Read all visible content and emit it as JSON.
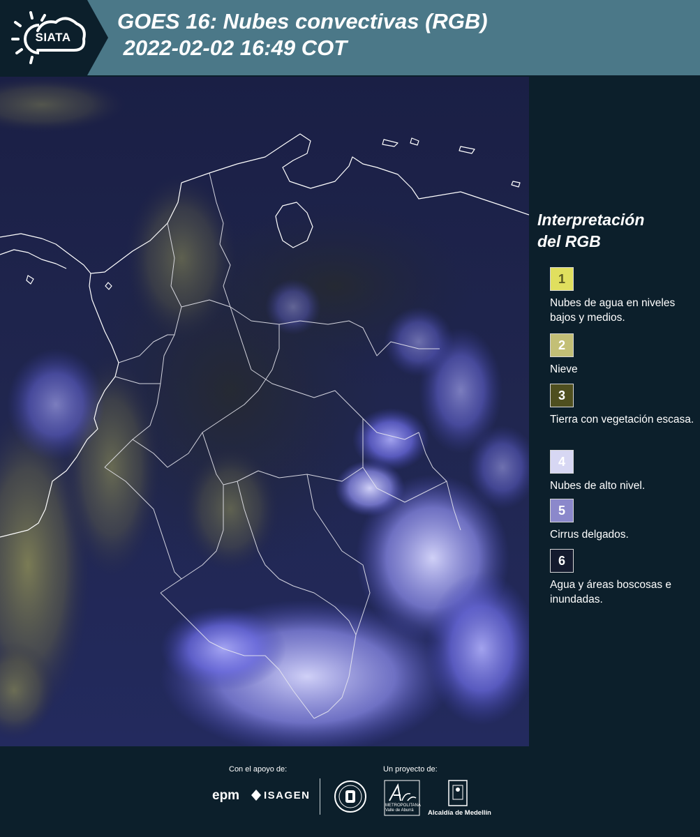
{
  "header": {
    "logo_text": "SIATA",
    "title": "GOES 16: Nubes convectivas (RGB)\n 2022-02-02 16:49 COT"
  },
  "legend": {
    "title": "Interpretación\ndel RGB",
    "items": [
      {
        "number": "1",
        "label": "Nubes de agua en niveles bajos y medios.",
        "color": "#e0df5e",
        "text_color": "#5a5a20"
      },
      {
        "number": "2",
        "label": "Nieve",
        "color": "#c3bf76",
        "text_color": "#ffffff"
      },
      {
        "number": "3",
        "label": "Tierra con vegetación escasa.",
        "color": "#4f4f1f",
        "text_color": "#ffffff"
      },
      {
        "number": "4",
        "label": "Nubes de alto nivel.",
        "color": "#d7d7f3",
        "text_color": "#ffffff"
      },
      {
        "number": "5",
        "label": "Cirrus delgados.",
        "color": "#8b88cb",
        "text_color": "#ffffff"
      },
      {
        "number": "6",
        "label": "Agua y áreas boscosas e inundadas.",
        "color": "#141a2e",
        "text_color": "#ffffff"
      }
    ]
  },
  "footer": {
    "support_label": "Con el apoyo de:",
    "project_label": "Un proyecto de:",
    "sponsors": [
      "epm",
      "ISAGEN"
    ],
    "partners": [
      "Área Metropolitana Valle de Aburrá",
      "Alcaldía de Medellín"
    ],
    "area_text": "METROPOLITANA\nValle de Aburrá",
    "alcaldia_text": "Alcaldía de Medellín",
    "epm_text": "epm",
    "isagen_text": "ISAGEN"
  },
  "colors": {
    "header_bg": "#4b7888",
    "dark_bg": "#0c1f2b",
    "map_bg": "#1c2552"
  }
}
